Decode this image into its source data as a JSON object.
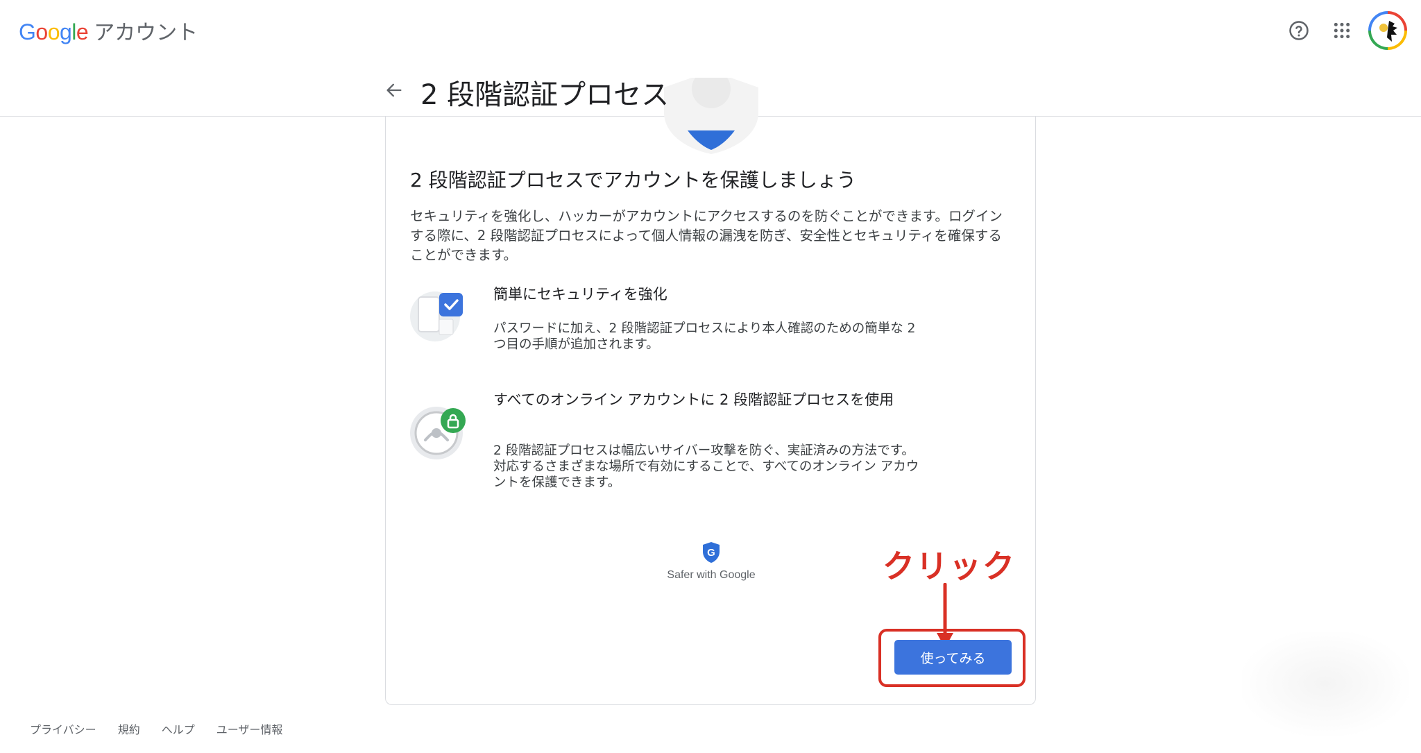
{
  "app": {
    "logo_google": "Google",
    "logo_product": "アカウント"
  },
  "topbar": {
    "icons": [
      "help-icon",
      "apps-grid-icon",
      "avatar"
    ]
  },
  "header": {
    "title": "2 段階認証プロセス"
  },
  "card": {
    "heading": "2 段階認証プロセスでアカウントを保護しましょう",
    "description": "セキュリティを強化し、ハッカーがアカウントにアクセスするのを防ぐことができます。ログインする際に、2 段階認証プロセスによって個人情報の漏洩を防ぎ、安全性とセキュリティを確保することができます。",
    "features": [
      {
        "title": "簡単にセキュリティを強化",
        "description": "パスワードに加え、2 段階認証プロセスにより本人確認のための簡単な 2 つ目の手順が追加されます。",
        "icon": "phone-check-icon"
      },
      {
        "title": "すべてのオンライン アカウントに 2 段階認証プロセスを使用",
        "description": "2 段階認証プロセスは幅広いサイバー攻撃を防ぐ、実証済みの方法です。対応するさまざまな場所で有効にすることで、すべてのオンライン アカウントを保護できます。",
        "icon": "lock-icon"
      }
    ],
    "safer_text": "Safer with Google",
    "cta_label": "使ってみる"
  },
  "annotation": {
    "label": "クリック"
  },
  "footer": {
    "links": [
      "プライバシー",
      "規約",
      "ヘルプ",
      "ユーザー情報"
    ]
  },
  "colors": {
    "primary_button": "#3c74dd",
    "annotation_red": "#d93025",
    "google_blue": "#4285f4",
    "google_red": "#ea4335",
    "google_yellow": "#fbbc05",
    "google_green": "#34a853"
  }
}
